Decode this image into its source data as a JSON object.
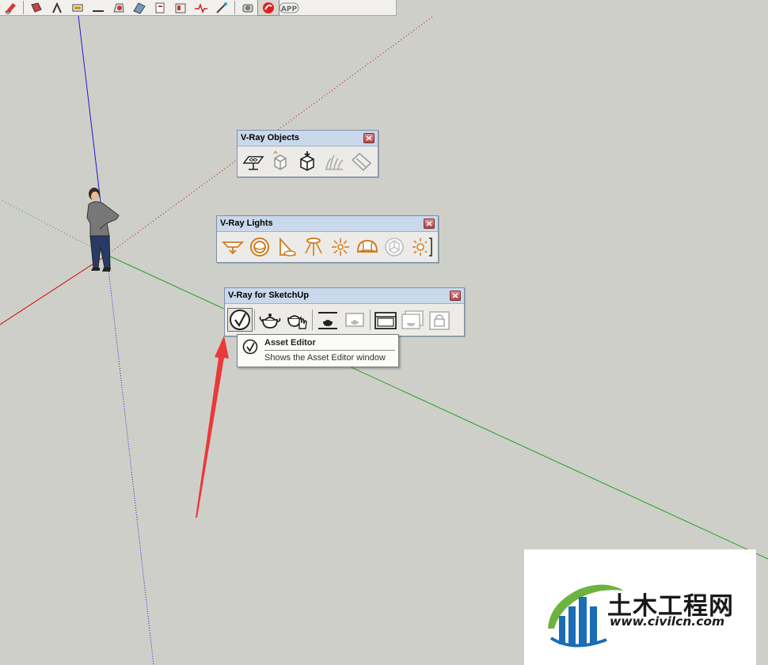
{
  "toolbar": {
    "icons": [
      "eraser-icon",
      "paint-bucket-icon",
      "walk-icon",
      "section-icon",
      "dimension-icon",
      "warehouse-icon",
      "extension-icon",
      "pages-icon",
      "dynamic-component-icon",
      "heartbeat-icon",
      "magic-wand-icon",
      "camera-icon",
      "sketchup-logo-icon",
      "app-icon"
    ],
    "app_label": "APP"
  },
  "panels": {
    "objects": {
      "title": "V-Ray Objects",
      "buttons": [
        "infinite-plane-icon",
        "proxy-import-icon",
        "proxy-export-icon",
        "fur-icon",
        "mesh-clipper-icon"
      ]
    },
    "lights": {
      "title": "V-Ray Lights",
      "buttons": [
        "rectangle-light-icon",
        "sphere-light-icon",
        "spot-light-icon",
        "ies-light-icon",
        "omni-light-icon",
        "dome-light-icon",
        "sphere-mesh-light-icon",
        "light-gen-icon"
      ]
    },
    "main": {
      "title": "V-Ray for SketchUp",
      "buttons": [
        "asset-editor-icon",
        "render-icon",
        "interactive-render-icon",
        "batch-render-icon",
        "render-cloud-icon",
        "frame-buffer-icon",
        "render-region-icon",
        "lock-camera-icon"
      ]
    }
  },
  "tooltip": {
    "title": "Asset Editor",
    "description": "Shows the Asset Editor window"
  },
  "watermark": {
    "chinese": "土木工程网",
    "url": "www.civilcn.com"
  },
  "colors": {
    "background": "#cfcfca",
    "vray_orange": "#d27a1e",
    "red_arrow": "#e8393b",
    "axis_red": "#d40000",
    "axis_green": "#1fa01f",
    "axis_blue": "#1a1ad0"
  }
}
